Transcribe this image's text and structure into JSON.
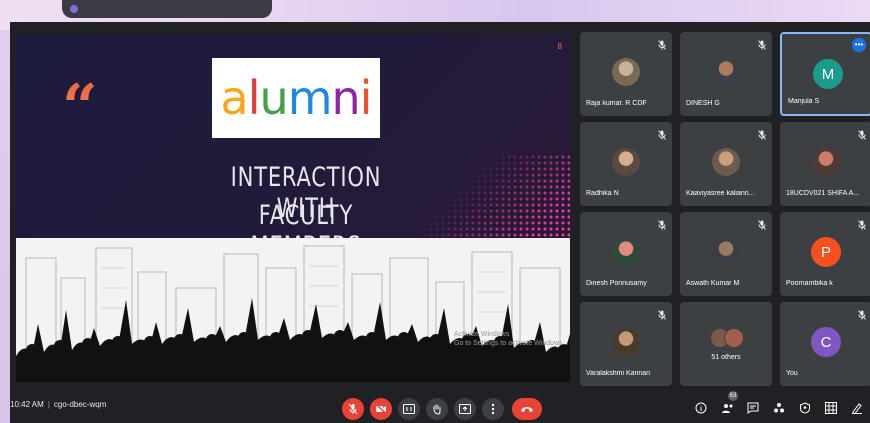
{
  "presentation_banner": "",
  "slide": {
    "page_number": "8",
    "quote_mark": "“",
    "logo_text": "alumni",
    "title_line1": "INTERACTION WITH",
    "title_line2": "FACULTY MEMBERS",
    "activate_line1": "Activate Windows",
    "activate_line2": "Go to Settings to activate Windows."
  },
  "participants": [
    {
      "name": "Raja kumar. R CDF",
      "type": "photo",
      "muted": true
    },
    {
      "name": "DINESH G",
      "type": "photo",
      "muted": true
    },
    {
      "name": "Manjula S",
      "type": "letter",
      "letter": "M",
      "color": "#1a9c8c",
      "muted": false,
      "active": true
    },
    {
      "name": "Radhika N",
      "type": "photo",
      "muted": true
    },
    {
      "name": "Kaaviyasree kaliann...",
      "type": "photo",
      "muted": true
    },
    {
      "name": "18UCDV021 SHIFA A...",
      "type": "photo",
      "muted": true
    },
    {
      "name": "Dinesh Ponnusamy",
      "type": "photo",
      "muted": true
    },
    {
      "name": "Aswath Kumar M",
      "type": "photo",
      "muted": true
    },
    {
      "name": "Poornambika k",
      "type": "letter",
      "letter": "P",
      "color": "#f4511e",
      "muted": true
    },
    {
      "name": "Varalakshmi Kannan",
      "type": "photo",
      "muted": true
    },
    {
      "name": "",
      "type": "others",
      "others_label": "51 others",
      "muted": false
    },
    {
      "name": "You",
      "type": "letter",
      "letter": "C",
      "color": "#7e57c2",
      "muted": true
    }
  ],
  "more_options_label": "•••",
  "bottom_bar": {
    "time": "10:42 AM",
    "separator": "|",
    "meeting_code": "cgo-dbec-wqm",
    "participants_count": "63"
  },
  "controls": [
    "mic-off-icon",
    "camera-off-icon",
    "captions-icon",
    "raise-hand-icon",
    "present-icon",
    "more-icon",
    "end-call-icon"
  ],
  "right_icons": [
    "info-icon",
    "people-icon",
    "chat-icon",
    "activities-icon",
    "host-controls-icon",
    "layout-icon",
    "whiteboard-icon"
  ]
}
